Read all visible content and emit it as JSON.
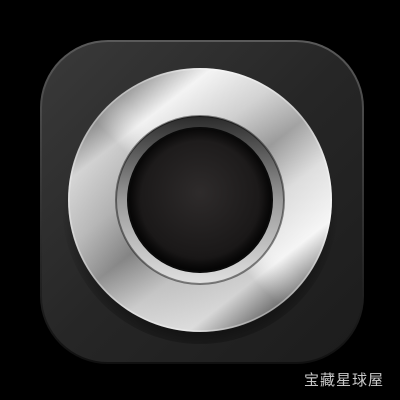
{
  "app_icon": {
    "icon_name": "metallic-ring-icon",
    "colors": {
      "background": "#000000",
      "tile_dark": "#1c1c1c",
      "tile_light": "#3a3a3a",
      "metal_light": "#f2f2f2",
      "metal_mid": "#9a9a9a",
      "metal_dark": "#3c3c3c",
      "center_dark": "#111111"
    }
  },
  "watermark": {
    "text": "宝藏星球屋"
  }
}
